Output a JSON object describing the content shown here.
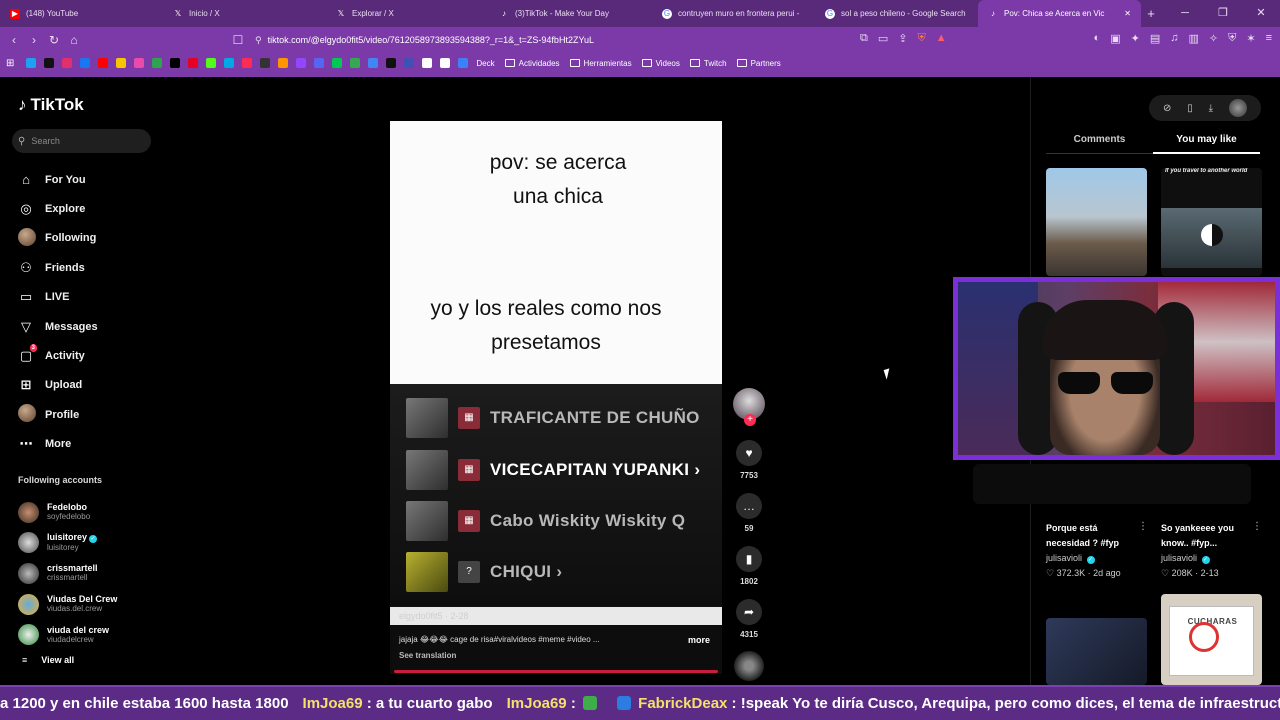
{
  "browser": {
    "tabs": [
      {
        "label": "(148) YouTube",
        "icon": "youtube-icon",
        "color": "#ff0000"
      },
      {
        "label": "Inicio / X",
        "icon": "x-icon",
        "color": "#000000"
      },
      {
        "label": "Explorar / X",
        "icon": "x-icon",
        "color": "#000000"
      },
      {
        "label": "(3)TikTok - Make Your Day",
        "icon": "tiktok-icon",
        "color": "#000000"
      },
      {
        "label": "contruyen muro en frontera perui -",
        "icon": "google-icon",
        "color": "#ffffff"
      },
      {
        "label": "sol a peso chileno - Google Search",
        "icon": "google-icon",
        "color": "#ffffff"
      },
      {
        "label": "Pov: Chica se Acerca en Vic",
        "icon": "tiktok-icon",
        "color": "#000000",
        "active": true
      }
    ],
    "url": "tiktok.com/@elgydo0fit5/video/7612058973893594388?_r=1&_t=ZS-94fbHt2ZYuL",
    "bookmarks": [
      "Deck",
      "Actividades",
      "Herramientas",
      "Videos",
      "Twitch",
      "Partners"
    ],
    "colors": {
      "chrome": "#7b3aa8",
      "tabstrip": "#5a2a7a"
    }
  },
  "sidebar": {
    "brand": "TikTok",
    "search_placeholder": "Search",
    "nav": [
      {
        "label": "For You",
        "icon": "home-icon"
      },
      {
        "label": "Explore",
        "icon": "compass-icon"
      },
      {
        "label": "Following",
        "icon": "avatar-icon"
      },
      {
        "label": "Friends",
        "icon": "friends-icon"
      },
      {
        "label": "LIVE",
        "icon": "live-icon"
      },
      {
        "label": "Messages",
        "icon": "messages-icon"
      },
      {
        "label": "Activity",
        "icon": "activity-icon",
        "badge": "3"
      },
      {
        "label": "Upload",
        "icon": "upload-icon"
      },
      {
        "label": "Profile",
        "icon": "profile-avatar-icon"
      },
      {
        "label": "More",
        "icon": "more-icon"
      }
    ],
    "following_title": "Following accounts",
    "accounts": [
      {
        "name": "Fedelobo",
        "user": "soyfedelobo",
        "verified": false
      },
      {
        "name": "luisitorey",
        "user": "luisitorey",
        "verified": true
      },
      {
        "name": "crissmartell",
        "user": "crissmartell",
        "verified": false
      },
      {
        "name": "Viudas Del Crew",
        "user": "viudas.del.crew",
        "verified": false
      },
      {
        "name": "viuda del crew",
        "user": "viudadelcrew",
        "verified": false
      }
    ],
    "view_all": "View all"
  },
  "video": {
    "caption_top": "pov: se acerca una chica",
    "caption_bottom": "yo y los reales como nos presetamos",
    "ranks": [
      {
        "text": "TRAFICANTE DE CHUÑO",
        "highlight": false
      },
      {
        "text": "VICECAPITAN YUPANKI ›",
        "highlight": true
      },
      {
        "text": "Cabo Wiskity Wiskity Q",
        "highlight": false
      },
      {
        "text": "CHIQUI ›",
        "highlight": false,
        "icon": "?"
      }
    ],
    "author_strip": "elgydo0fit5 · 2-28",
    "description": "jajaja 😂😂😂 cage de risa#viralvideos #meme #video ...",
    "more": "more",
    "see_translation": "See translation",
    "actions": [
      {
        "icon": "heart-icon",
        "count": "7753"
      },
      {
        "icon": "comment-icon",
        "count": "59"
      },
      {
        "icon": "bookmark-icon",
        "count": "1802"
      },
      {
        "icon": "share-icon",
        "count": "4315"
      }
    ]
  },
  "right_panel": {
    "tabs": [
      "Comments",
      "You may like"
    ],
    "active_tab": "You may like",
    "thumb2_tag": "If you travel to another world",
    "items": [
      {
        "title": "Porque está necesidad ? #fyp",
        "author": "julisavioli",
        "stats": "372.3K · 2d ago"
      },
      {
        "title": "So yankeeee you know.. #fyp...",
        "author": "julisavioli",
        "stats": "208K · 2-13"
      }
    ],
    "thumb4_sign": "CUCHARAS"
  },
  "ticker": {
    "messages": [
      {
        "user": "",
        "text": "a 1200 y en chile estaba 1600 hasta 1800"
      },
      {
        "user": "ImJoa69",
        "text": ": a tu cuarto gabo"
      },
      {
        "user": "ImJoa69",
        "text": ":"
      },
      {
        "user": "FabrickDeax",
        "text": ": !speak Yo te diría Cusco, Arequipa, pero como dices, el tema de infraestructura"
      }
    ],
    "colors": {
      "bg": "#5c2b86",
      "user": "#f4e06a"
    }
  }
}
